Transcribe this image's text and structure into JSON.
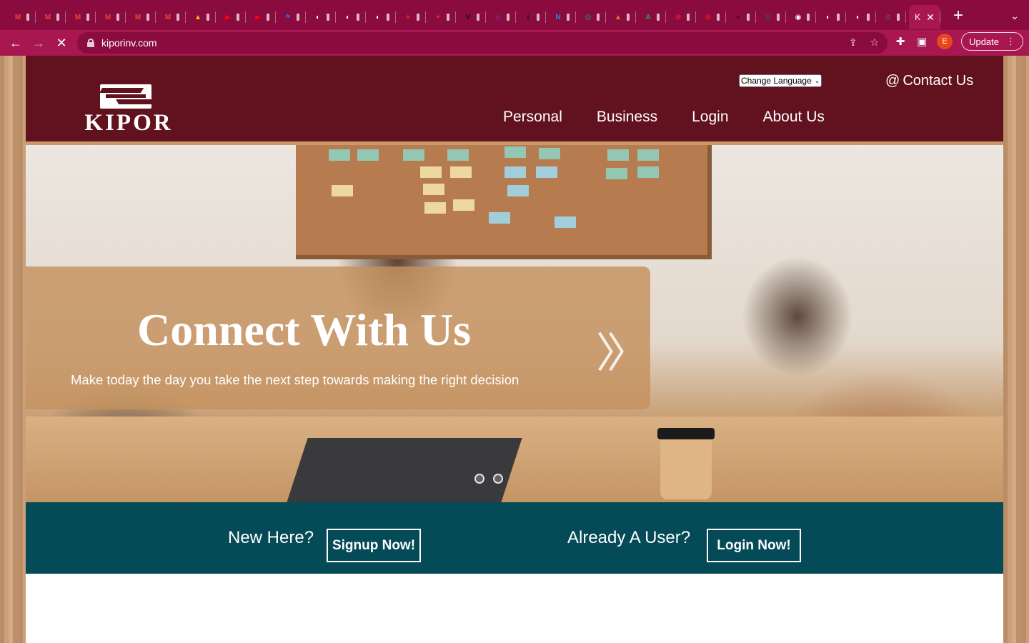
{
  "browser": {
    "tabs": [
      {
        "icon": "gmail-icon",
        "color": "#ea4335",
        "glyph": "M"
      },
      {
        "icon": "gmail-icon",
        "color": "#ea4335",
        "glyph": "M"
      },
      {
        "icon": "gmail-icon",
        "color": "#ea4335",
        "glyph": "M"
      },
      {
        "icon": "gmail-icon",
        "color": "#ea4335",
        "glyph": "M"
      },
      {
        "icon": "gmail-icon",
        "color": "#ea4335",
        "glyph": "M"
      },
      {
        "icon": "gmail-icon",
        "color": "#ea4335",
        "glyph": "M"
      },
      {
        "icon": "google-drive-icon",
        "color": "#fbbc04",
        "glyph": "▲"
      },
      {
        "icon": "youtube-icon",
        "color": "#ff0000",
        "glyph": "▶"
      },
      {
        "icon": "youtube-icon",
        "color": "#ff0000",
        "glyph": "▶"
      },
      {
        "icon": "flag-icon",
        "color": "#3b5bdb",
        "glyph": "⚑"
      },
      {
        "icon": "globe-icon",
        "color": "#ffffff",
        "glyph": "◐"
      },
      {
        "icon": "globe-icon",
        "color": "#ffffff",
        "glyph": "◐"
      },
      {
        "icon": "globe-icon",
        "color": "#ffffff",
        "glyph": "◐"
      },
      {
        "icon": "maple-leaf-icon",
        "color": "#d52b1e",
        "glyph": "✦"
      },
      {
        "icon": "maple-leaf-icon",
        "color": "#d52b1e",
        "glyph": "✦"
      },
      {
        "icon": "v-logo-icon",
        "color": "#111111",
        "glyph": "V"
      },
      {
        "icon": "coloring-icon",
        "color": "#6b3fa0",
        "glyph": "c"
      },
      {
        "icon": "info-icon",
        "color": "#111111",
        "glyph": "i"
      },
      {
        "icon": "n-logo-icon",
        "color": "#1e88e5",
        "glyph": "N"
      },
      {
        "icon": "openai-icon",
        "color": "#10a37f",
        "glyph": "◎"
      },
      {
        "icon": "mountain-icon",
        "color": "#e0762a",
        "glyph": "▲"
      },
      {
        "icon": "green-a-icon",
        "color": "#1fa34a",
        "glyph": "A"
      },
      {
        "icon": "red-shield-icon",
        "color": "#c8102e",
        "glyph": "⬢"
      },
      {
        "icon": "red-shield-icon",
        "color": "#c8102e",
        "glyph": "⬢"
      },
      {
        "icon": "dark-dot-icon",
        "color": "#4a1025",
        "glyph": "●"
      },
      {
        "icon": "uk-icon",
        "color": "#35507a",
        "glyph": "U"
      },
      {
        "icon": "github-icon",
        "color": "#ffffff",
        "glyph": "◉"
      },
      {
        "icon": "globe-icon",
        "color": "#ffffff",
        "glyph": "◐"
      },
      {
        "icon": "globe-icon",
        "color": "#ffffff",
        "glyph": "◐"
      },
      {
        "icon": "green-robot-icon",
        "color": "#34a853",
        "glyph": "☺"
      }
    ],
    "active_tab_label": "K",
    "url": "kiporinv.com",
    "update_label": "Update",
    "profile_initial": "E"
  },
  "site": {
    "logo_text": "KIPOR",
    "language_select": "Change Language",
    "contact_label": "Contact Us",
    "nav": [
      "Personal",
      "Business",
      "Login",
      "About Us"
    ],
    "hero": {
      "title": "Connect With Us",
      "subtitle": "Make today the day you take the next step towards making the right decision"
    },
    "cta": {
      "new_here": "New Here?",
      "signup": "Signup Now!",
      "already_user": "Already A User?",
      "login": "Login Now!"
    },
    "colors": {
      "header": "#61121e",
      "cta_band": "#044a57",
      "caption_box": "#c4915e"
    }
  }
}
